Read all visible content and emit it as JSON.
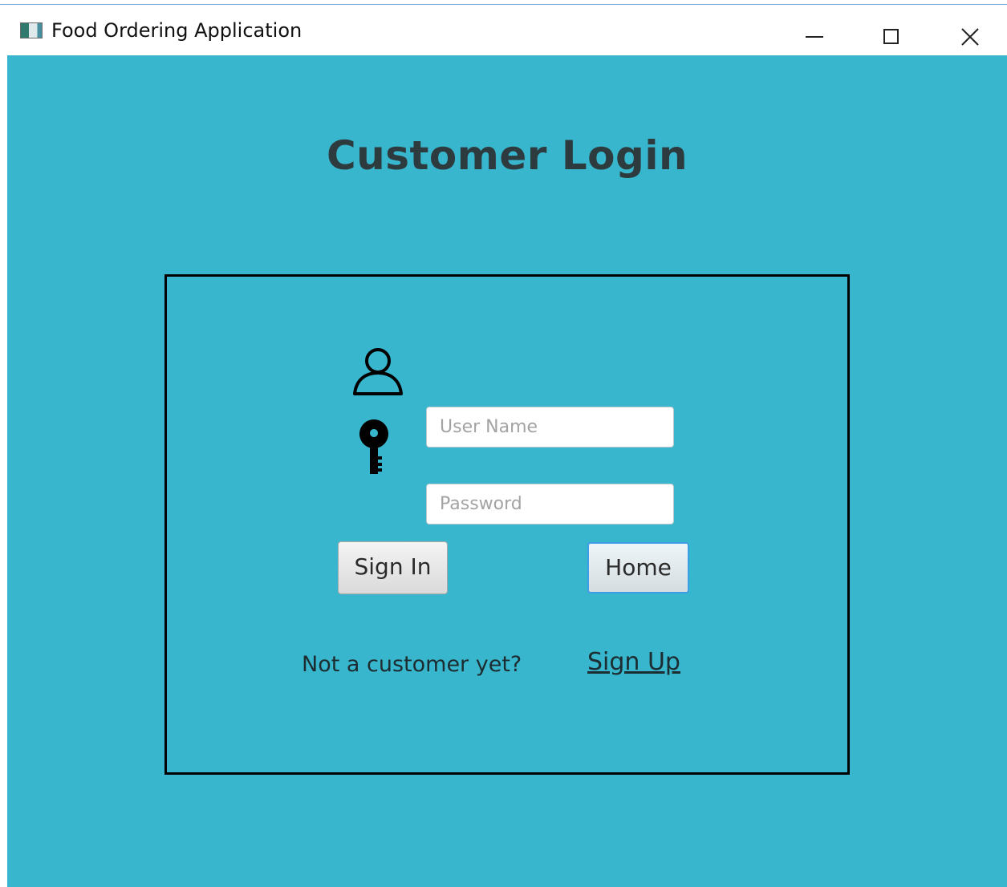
{
  "window": {
    "title": "Food Ordering Application",
    "icon": "app-window-icon",
    "controls": {
      "minimize_icon": "minimize-icon",
      "maximize_icon": "maximize-icon",
      "close_icon": "close-icon"
    }
  },
  "colors": {
    "background": "#38b6cd",
    "panel_border": "#000000",
    "heading_text": "#2d3b3f",
    "focus_border": "#3d9ee6"
  },
  "heading": "Customer Login",
  "form": {
    "username": {
      "icon": "user-icon",
      "value": "",
      "placeholder": "User Name"
    },
    "password": {
      "icon": "key-icon",
      "value": "",
      "placeholder": "Password"
    },
    "sign_in_label": "Sign In",
    "home_label": "Home"
  },
  "signup_prompt": {
    "text": "Not a customer yet?",
    "link_label": "Sign Up"
  }
}
